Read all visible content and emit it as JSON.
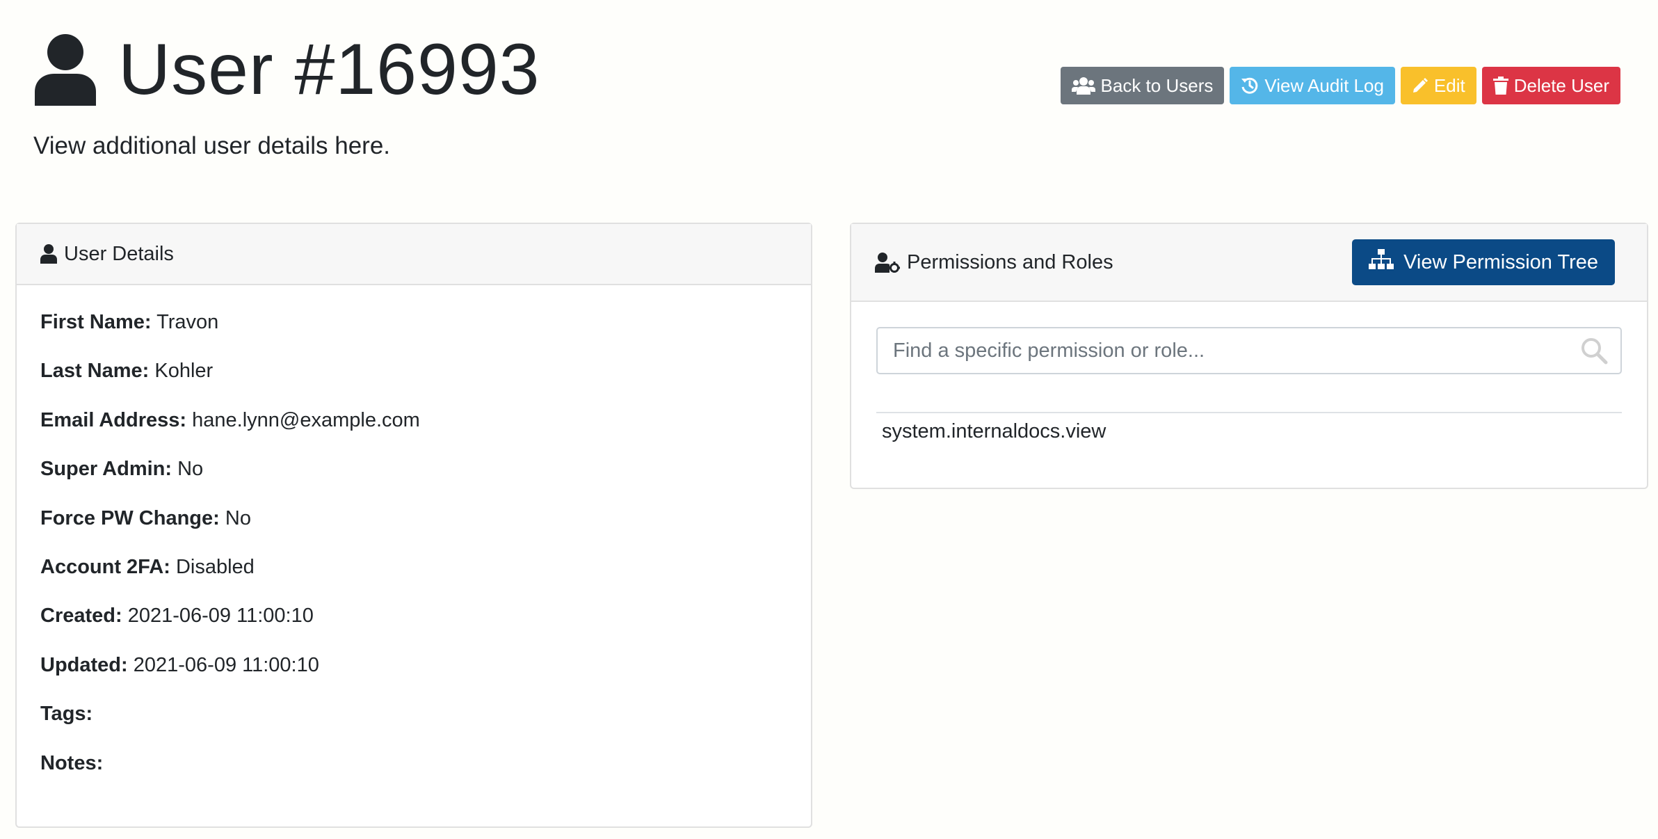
{
  "page": {
    "title": "User #16993",
    "subtitle": "View additional user details here."
  },
  "actions": {
    "back": "Back to Users",
    "audit": "View Audit Log",
    "edit": "Edit",
    "delete": "Delete User"
  },
  "user_details": {
    "header": "User Details",
    "fields": [
      {
        "label": "First Name:",
        "value": "Travon"
      },
      {
        "label": "Last Name:",
        "value": "Kohler"
      },
      {
        "label": "Email Address:",
        "value": "hane.lynn@example.com"
      },
      {
        "label": "Super Admin:",
        "value": "No"
      },
      {
        "label": "Force PW Change:",
        "value": "No"
      },
      {
        "label": "Account 2FA:",
        "value": "Disabled"
      },
      {
        "label": "Created:",
        "value": "2021-06-09 11:00:10"
      },
      {
        "label": "Updated:",
        "value": "2021-06-09 11:00:10"
      },
      {
        "label": "Tags:",
        "value": ""
      },
      {
        "label": "Notes:",
        "value": ""
      }
    ]
  },
  "permissions": {
    "header": "Permissions and Roles",
    "tree_button": "View Permission Tree",
    "search_placeholder": "Find a specific permission or role...",
    "search_value": "",
    "items": [
      "system.internaldocs.view"
    ]
  },
  "icons": {
    "title": "user-icon",
    "back": "users-icon",
    "audit": "history-icon",
    "edit": "pencil-icon",
    "delete": "trash-icon",
    "details": "user-icon",
    "permissions": "user-cog-icon",
    "tree": "sitemap-icon",
    "search": "search-icon"
  },
  "colors": {
    "back": "#6c757d",
    "audit": "#54b6e8",
    "edit": "#f9c02b",
    "delete": "#dc3545",
    "tree": "#0b4a86"
  }
}
